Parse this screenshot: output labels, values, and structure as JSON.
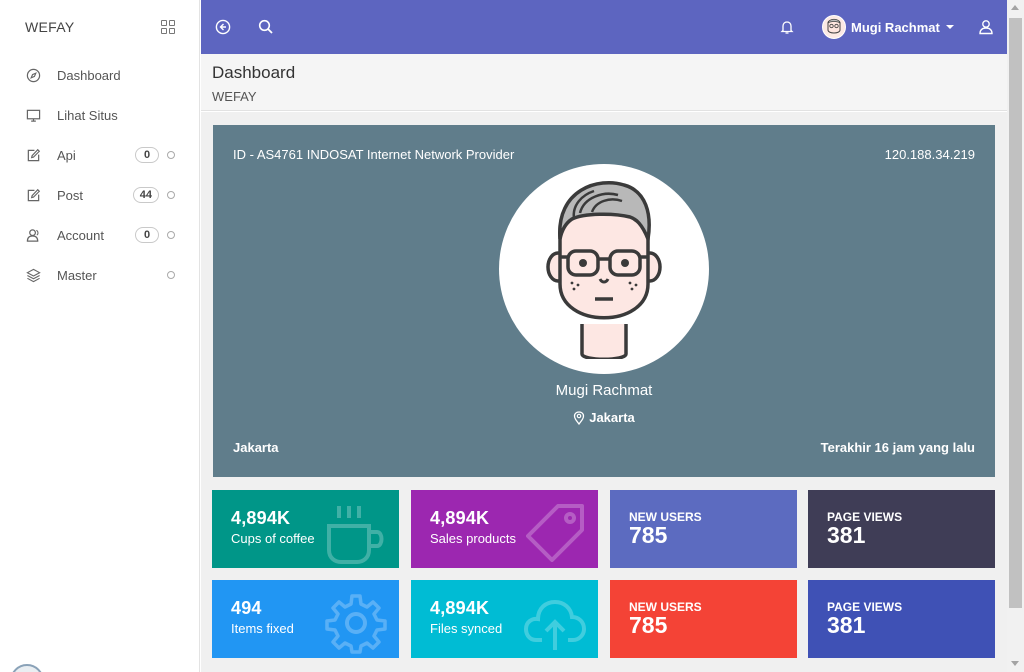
{
  "sidebar": {
    "brand": "WEFAY",
    "items": [
      {
        "label": "Dashboard",
        "icon": "compass-icon"
      },
      {
        "label": "Lihat Situs",
        "icon": "monitor-icon"
      },
      {
        "label": "Api",
        "icon": "edit-icon",
        "badge": "0"
      },
      {
        "label": "Post",
        "icon": "edit-icon",
        "badge": "44"
      },
      {
        "label": "Account",
        "icon": "users-icon",
        "badge": "0"
      },
      {
        "label": "Master",
        "icon": "layers-icon"
      }
    ]
  },
  "topbar": {
    "user_name": "Mugi Rachmat",
    "color": "#5d65c0"
  },
  "header": {
    "title": "Dashboard",
    "subtitle": "WEFAY"
  },
  "profile": {
    "isp": "ID - AS4761 INDOSAT Internet Network Provider",
    "ip": "120.188.34.219",
    "name": "Mugi Rachmat",
    "location": "Jakarta",
    "city": "Jakarta",
    "last_seen": "Terakhir 16 jam yang lalu",
    "color": "#607d8b"
  },
  "tiles": [
    {
      "value": "4,894K",
      "label": "Cups of coffee",
      "color": "#009688",
      "icon": "coffee-cup-icon"
    },
    {
      "value": "4,894K",
      "label": "Sales products",
      "color": "#9c27b0",
      "icon": "price-tag-icon"
    },
    {
      "caption": "NEW USERS",
      "value": "785",
      "color": "#5c6bc0"
    },
    {
      "caption": "PAGE VIEWS",
      "value": "381",
      "color": "#3f3d56"
    },
    {
      "value": "494",
      "label": "Items fixed",
      "color": "#2196f3",
      "icon": "gear-icon"
    },
    {
      "value": "4,894K",
      "label": "Files synced",
      "color": "#00bcd4",
      "icon": "cloud-upload-icon"
    },
    {
      "caption": "NEW USERS",
      "value": "785",
      "color": "#f44336"
    },
    {
      "caption": "PAGE VIEWS",
      "value": "381",
      "color": "#3f51b5"
    }
  ]
}
